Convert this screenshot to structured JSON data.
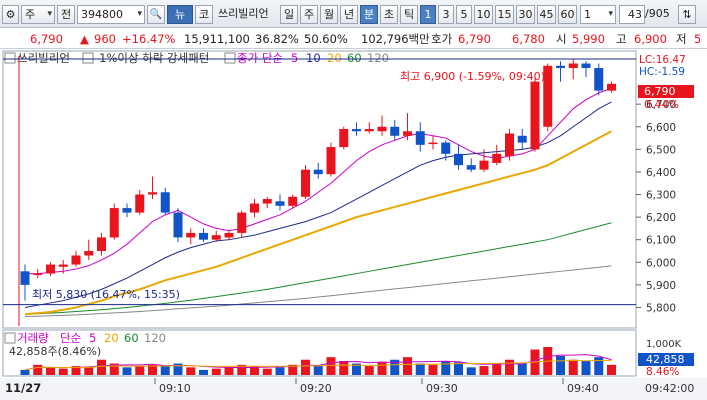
{
  "toolbar": {
    "gear": "⚙",
    "market": "주",
    "market_dd": "▾",
    "cat": "전",
    "code": "394800",
    "search": "🔍",
    "down": "▾",
    "news": "뉴",
    "news_dd": "▾",
    "code_label": "코",
    "stock_name": "쓰리빌리언",
    "periods": [
      "일",
      "주",
      "월",
      "년",
      "분",
      "초",
      "틱"
    ],
    "active_period": "분",
    "intervals": [
      "1",
      "3",
      "5",
      "10",
      "15",
      "30",
      "45",
      "60"
    ],
    "active_interval": "1",
    "interval_select": "1",
    "count": "43",
    "total": "/905",
    "extra": "⇅"
  },
  "quote": {
    "price": "6,790",
    "change": "960",
    "change_pct": "+16.47%",
    "volume": "15,911,100",
    "turnover_ratio": "36.82%",
    "power": "50.60%",
    "amount": "102,796백만",
    "hoga_label": "호가",
    "ask": "6,790",
    "bid": "6,780",
    "open_label": "시",
    "open": "5,990",
    "high_label": "고",
    "high": "6,900",
    "low_label": "저",
    "low": "5"
  },
  "chart_header": {
    "name": "쓰리빌리언",
    "pattern": "-1%이상 하락 강세패턴",
    "ma_label": "종가 단순",
    "ma_periods": [
      "5",
      "10",
      "20",
      "60",
      "120"
    ]
  },
  "annotations": {
    "high_label": "최고 6,900 (-1.59%, 09:40)",
    "low_label": "최저 5,830 (16.47%, 15:35)",
    "lc": "LC:16.47",
    "hc": "HC:-1.59",
    "price_tag": "6,790",
    "pct_tag": "0.44%"
  },
  "volume_header": {
    "label": "거래량",
    "ma_label": "단순",
    "ma_periods": [
      "5",
      "20",
      "60",
      "120"
    ],
    "current": "42,858주(8.46%)",
    "tag": "42,858",
    "pct_tag": "8.46%",
    "axis_unit": "1,000K"
  },
  "time_axis": {
    "date": "11/27",
    "labels": [
      "09:10",
      "09:20",
      "09:30",
      "09:40"
    ],
    "last": "09:42:00"
  },
  "colors": {
    "up": "#e8141e",
    "down": "#1054c8",
    "ma5": "#cc00cc",
    "ma10": "#1a2a8a",
    "ma20": "#e8a800",
    "ma60": "#1a8a2a",
    "ma120": "#888888"
  },
  "chart_data": {
    "type": "candlestick",
    "interval": "1분",
    "price_ticks": [
      5800,
      5900,
      6000,
      6100,
      6200,
      6300,
      6400,
      6500,
      6600,
      6700
    ],
    "price_range": [
      5750,
      6900
    ],
    "candles": [
      {
        "o": 5960,
        "h": 5990,
        "l": 5830,
        "c": 5900
      },
      {
        "o": 5950,
        "h": 5970,
        "l": 5930,
        "c": 5950
      },
      {
        "o": 5950,
        "h": 6000,
        "l": 5940,
        "c": 5990
      },
      {
        "o": 5980,
        "h": 6010,
        "l": 5950,
        "c": 5990
      },
      {
        "o": 5990,
        "h": 6050,
        "l": 5980,
        "c": 6030
      },
      {
        "o": 6030,
        "h": 6100,
        "l": 6010,
        "c": 6050
      },
      {
        "o": 6050,
        "h": 6130,
        "l": 6030,
        "c": 6110
      },
      {
        "o": 6110,
        "h": 6260,
        "l": 6100,
        "c": 6240
      },
      {
        "o": 6240,
        "h": 6260,
        "l": 6200,
        "c": 6220
      },
      {
        "o": 6220,
        "h": 6320,
        "l": 6210,
        "c": 6300
      },
      {
        "o": 6300,
        "h": 6380,
        "l": 6280,
        "c": 6310
      },
      {
        "o": 6310,
        "h": 6330,
        "l": 6210,
        "c": 6220
      },
      {
        "o": 6220,
        "h": 6240,
        "l": 6090,
        "c": 6110
      },
      {
        "o": 6110,
        "h": 6150,
        "l": 6080,
        "c": 6130
      },
      {
        "o": 6130,
        "h": 6150,
        "l": 6090,
        "c": 6100
      },
      {
        "o": 6100,
        "h": 6140,
        "l": 6090,
        "c": 6120
      },
      {
        "o": 6110,
        "h": 6140,
        "l": 6100,
        "c": 6130
      },
      {
        "o": 6130,
        "h": 6230,
        "l": 6110,
        "c": 6220
      },
      {
        "o": 6220,
        "h": 6280,
        "l": 6200,
        "c": 6260
      },
      {
        "o": 6260,
        "h": 6290,
        "l": 6240,
        "c": 6280
      },
      {
        "o": 6270,
        "h": 6300,
        "l": 6230,
        "c": 6250
      },
      {
        "o": 6250,
        "h": 6300,
        "l": 6240,
        "c": 6290
      },
      {
        "o": 6290,
        "h": 6430,
        "l": 6280,
        "c": 6410
      },
      {
        "o": 6410,
        "h": 6440,
        "l": 6370,
        "c": 6390
      },
      {
        "o": 6390,
        "h": 6530,
        "l": 6380,
        "c": 6510
      },
      {
        "o": 6510,
        "h": 6600,
        "l": 6500,
        "c": 6590
      },
      {
        "o": 6590,
        "h": 6620,
        "l": 6560,
        "c": 6580
      },
      {
        "o": 6580,
        "h": 6620,
        "l": 6570,
        "c": 6590
      },
      {
        "o": 6580,
        "h": 6650,
        "l": 6560,
        "c": 6600
      },
      {
        "o": 6600,
        "h": 6630,
        "l": 6540,
        "c": 6560
      },
      {
        "o": 6560,
        "h": 6660,
        "l": 6540,
        "c": 6580
      },
      {
        "o": 6580,
        "h": 6620,
        "l": 6490,
        "c": 6520
      },
      {
        "o": 6530,
        "h": 6560,
        "l": 6500,
        "c": 6530
      },
      {
        "o": 6530,
        "h": 6540,
        "l": 6450,
        "c": 6480
      },
      {
        "o": 6480,
        "h": 6520,
        "l": 6410,
        "c": 6430
      },
      {
        "o": 6430,
        "h": 6460,
        "l": 6400,
        "c": 6410
      },
      {
        "o": 6410,
        "h": 6500,
        "l": 6400,
        "c": 6450
      },
      {
        "o": 6440,
        "h": 6520,
        "l": 6430,
        "c": 6480
      },
      {
        "o": 6470,
        "h": 6590,
        "l": 6450,
        "c": 6570
      },
      {
        "o": 6560,
        "h": 6590,
        "l": 6500,
        "c": 6530
      },
      {
        "o": 6500,
        "h": 6820,
        "l": 6490,
        "c": 6800
      },
      {
        "o": 6600,
        "h": 6880,
        "l": 6580,
        "c": 6870
      },
      {
        "o": 6870,
        "h": 6890,
        "l": 6800,
        "c": 6860
      },
      {
        "o": 6860,
        "h": 6900,
        "l": 6810,
        "c": 6880
      },
      {
        "o": 6880,
        "h": 6890,
        "l": 6820,
        "c": 6860
      },
      {
        "o": 6860,
        "h": 6880,
        "l": 6740,
        "c": 6760
      },
      {
        "o": 6760,
        "h": 6800,
        "l": 6750,
        "c": 6790
      }
    ],
    "ma5": [
      5950,
      5950,
      5955,
      5960,
      5970,
      5985,
      6010,
      6040,
      6080,
      6130,
      6180,
      6210,
      6230,
      6200,
      6170,
      6150,
      6140,
      6150,
      6170,
      6190,
      6210,
      6240,
      6270,
      6310,
      6350,
      6400,
      6450,
      6490,
      6520,
      6540,
      6560,
      6570,
      6560,
      6550,
      6520,
      6490,
      6470,
      6460,
      6470,
      6480,
      6500,
      6560,
      6620,
      6680,
      6720,
      6750,
      6770
    ],
    "ma10": [
      5800,
      5810,
      5820,
      5830,
      5845,
      5860,
      5880,
      5905,
      5930,
      5960,
      5990,
      6020,
      6045,
      6065,
      6080,
      6095,
      6100,
      6110,
      6120,
      6135,
      6150,
      6165,
      6180,
      6200,
      6220,
      6250,
      6280,
      6310,
      6340,
      6370,
      6400,
      6430,
      6450,
      6465,
      6475,
      6480,
      6485,
      6490,
      6495,
      6500,
      6510,
      6530,
      6560,
      6600,
      6640,
      6680,
      6710
    ],
    "ma20": [
      5770,
      5775,
      5780,
      5790,
      5800,
      5815,
      5830,
      5850,
      5865,
      5880,
      5900,
      5920,
      5935,
      5950,
      5965,
      5980,
      6000,
      6020,
      6040,
      6060,
      6080,
      6100,
      6120,
      6140,
      6160,
      6180,
      6200,
      6215,
      6230,
      6245,
      6260,
      6275,
      6290,
      6305,
      6320,
      6335,
      6350,
      6365,
      6380,
      6395,
      6410,
      6430,
      6460,
      6490,
      6520,
      6550,
      6580
    ],
    "ma60": [
      5770,
      5772,
      5775,
      5778,
      5782,
      5786,
      5790,
      5795,
      5800,
      5806,
      5812,
      5818,
      5825,
      5832,
      5840,
      5848,
      5856,
      5864,
      5872,
      5880,
      5890,
      5900,
      5910,
      5920,
      5930,
      5940,
      5950,
      5960,
      5970,
      5980,
      5990,
      6000,
      6010,
      6020,
      6030,
      6040,
      6050,
      6060,
      6070,
      6080,
      6090,
      6100,
      6115,
      6130,
      6145,
      6160,
      6175
    ],
    "ma120": [
      5760,
      5761,
      5763,
      5765,
      5767,
      5770,
      5773,
      5776,
      5779,
      5782,
      5786,
      5790,
      5794,
      5798,
      5802,
      5806,
      5810,
      5815,
      5820,
      5825,
      5830,
      5835,
      5840,
      5846,
      5852,
      5858,
      5864,
      5870,
      5876,
      5882,
      5888,
      5894,
      5900,
      5906,
      5912,
      5918,
      5924,
      5930,
      5936,
      5942,
      5948,
      5954,
      5960,
      5966,
      5972,
      5978,
      5984
    ],
    "volume": [
      20,
      40,
      30,
      25,
      35,
      30,
      60,
      45,
      30,
      35,
      40,
      35,
      45,
      30,
      20,
      25,
      30,
      40,
      35,
      25,
      30,
      40,
      60,
      35,
      70,
      55,
      45,
      35,
      50,
      60,
      70,
      45,
      40,
      55,
      50,
      30,
      35,
      45,
      60,
      45,
      100,
      110,
      75,
      60,
      55,
      70,
      40
    ],
    "volume_max": 1000,
    "low_line": 5830,
    "high_line": 6900
  }
}
